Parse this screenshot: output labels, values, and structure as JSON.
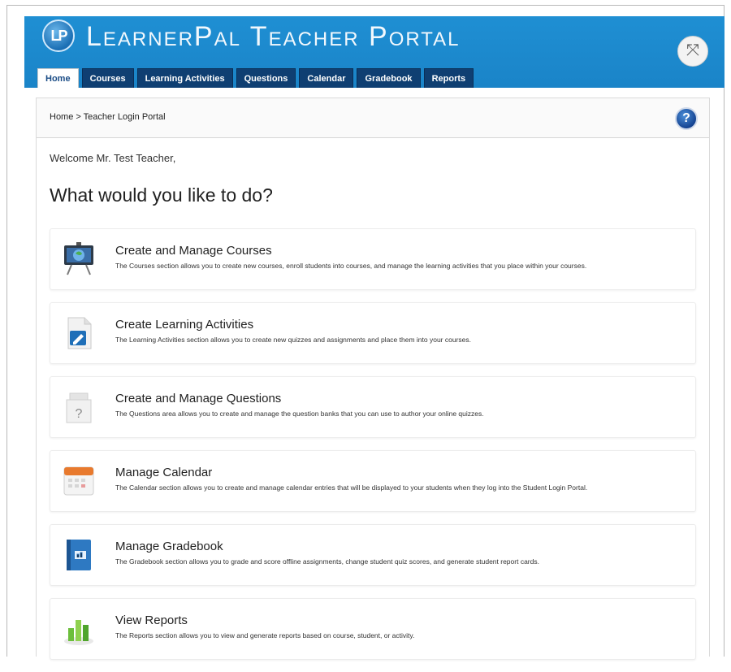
{
  "header": {
    "logo_text": "LP",
    "title": "LearnerPal Teacher Portal",
    "expand_glyph": "⤧"
  },
  "tabs": [
    {
      "label": "Home"
    },
    {
      "label": "Courses"
    },
    {
      "label": "Learning Activities"
    },
    {
      "label": "Questions"
    },
    {
      "label": "Calendar"
    },
    {
      "label": "Gradebook"
    },
    {
      "label": "Reports"
    }
  ],
  "breadcrumb": "Home > Teacher Login Portal",
  "help_glyph": "?",
  "welcome": "Welcome Mr. Test Teacher,",
  "headline": "What would you like to do?",
  "cards": [
    {
      "title": "Create and Manage Courses",
      "desc": "The Courses section allows you to create new courses, enroll students into courses, and manage the learning activities that you place within your courses.",
      "icon": "presentation-board-icon"
    },
    {
      "title": "Create Learning Activities",
      "desc": "The Learning Activities section allows you to create new quizzes and assignments and place them into your courses.",
      "icon": "document-edit-icon"
    },
    {
      "title": "Create and Manage Questions",
      "desc": "The Questions area allows you to create and manage the question banks that you can use to author your online quizzes.",
      "icon": "question-document-icon"
    },
    {
      "title": "Manage Calendar",
      "desc": "The Calendar section allows you to create and manage calendar entries that will be displayed to your students when they log into the Student Login Portal.",
      "icon": "calendar-icon"
    },
    {
      "title": "Manage Gradebook",
      "desc": "The Gradebook section allows you to grade and score offline assignments, change student quiz scores, and generate student report cards.",
      "icon": "gradebook-icon"
    },
    {
      "title": "View Reports",
      "desc": "The Reports section allows you to view and generate reports based on course, student, or activity.",
      "icon": "bar-chart-icon"
    }
  ],
  "colors": {
    "header_blue": "#1a84c8",
    "tab_navy": "#0f3f72",
    "help_blue": "#123f8d"
  }
}
